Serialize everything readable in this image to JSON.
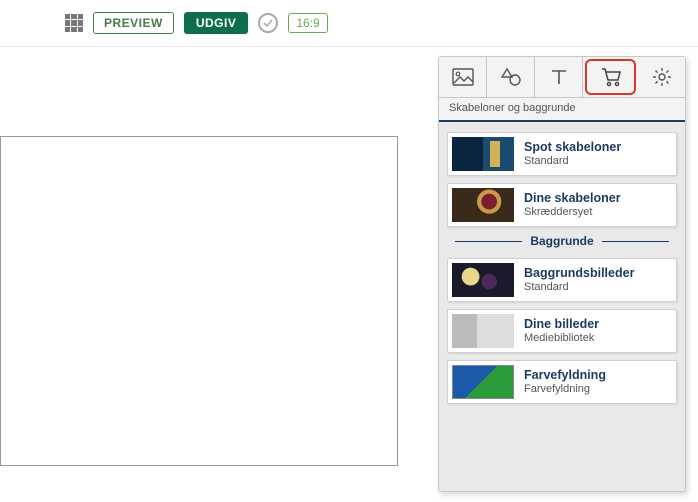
{
  "toolbar": {
    "preview_label": "PREVIEW",
    "publish_label": "UDGIV",
    "aspect_ratio": "16:9"
  },
  "panel": {
    "label": "Skabeloner og baggrunde",
    "backgrounds_heading": "Baggrunde",
    "templates": [
      {
        "title": "Spot skabeloner",
        "subtitle": "Standard"
      },
      {
        "title": "Dine skabeloner",
        "subtitle": "Skræddersyet"
      }
    ],
    "backgrounds": [
      {
        "title": "Baggrundsbilleder",
        "subtitle": "Standard"
      },
      {
        "title": "Dine billeder",
        "subtitle": "Mediebibliotek"
      },
      {
        "title": "Farvefyldning",
        "subtitle": "Farvefyldning"
      }
    ]
  }
}
